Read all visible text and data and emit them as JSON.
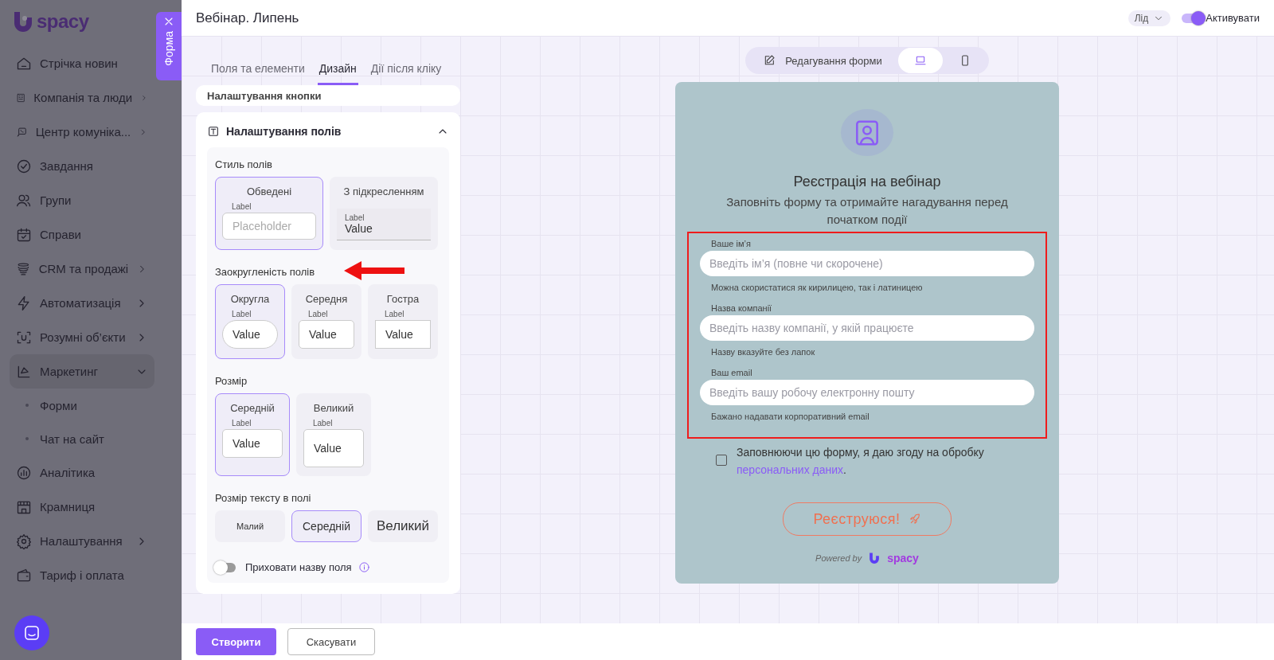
{
  "sidebar": {
    "logo": "spacy",
    "form_tab": "Форма",
    "items": [
      {
        "label": "Стрічка новин",
        "expandable": false
      },
      {
        "label": "Компанія та люди",
        "expandable": true,
        "expanded": false
      },
      {
        "label": "Центр комуніка...",
        "expandable": true,
        "expanded": false
      },
      {
        "label": "Завдання",
        "expandable": false
      },
      {
        "label": "Групи",
        "expandable": false
      },
      {
        "label": "Справи",
        "expandable": false
      },
      {
        "label": "CRM та продажі",
        "expandable": true,
        "expanded": false
      },
      {
        "label": "Автоматизація",
        "expandable": true,
        "expanded": false
      },
      {
        "label": "Розумні об’єкти",
        "expandable": true,
        "expanded": false
      },
      {
        "label": "Маркетинг",
        "expandable": true,
        "expanded": true,
        "children": [
          {
            "label": "Форми"
          },
          {
            "label": "Чат на сайт"
          }
        ]
      },
      {
        "label": "Аналітика",
        "expandable": false
      },
      {
        "label": "Крамниця",
        "expandable": false
      },
      {
        "label": "Налаштування",
        "expandable": true,
        "expanded": false
      },
      {
        "label": "Тариф і оплата",
        "expandable": false
      }
    ]
  },
  "header": {
    "title": "Вебінар. Липень",
    "entity": "Лід",
    "activate": {
      "label": "Активувати",
      "on": true
    }
  },
  "settings": {
    "tabs": [
      {
        "label": "Поля та елементи",
        "selected": false
      },
      {
        "label": "Дизайн",
        "selected": true
      },
      {
        "label": "Дії після кліку",
        "selected": false
      }
    ],
    "collapsed_section": "Налаштування кнопки",
    "section": {
      "title": "Налаштування полів",
      "expanded": true,
      "groups": [
        {
          "title": "Стиль полів",
          "kind": "style",
          "options": [
            {
              "title": "Обведені",
              "kind": "outlined",
              "selected": true,
              "label": "Label",
              "placeholder": "Placeholder"
            },
            {
              "title": "З підкресленням",
              "kind": "underlined",
              "selected": false,
              "label": "Label",
              "value": "Value"
            }
          ]
        },
        {
          "title": "Заокругленість полів",
          "kind": "radius",
          "options": [
            {
              "title": "Округла",
              "kind": "round",
              "selected": true,
              "label": "Label",
              "value": "Value"
            },
            {
              "title": "Середня",
              "kind": "medium",
              "selected": false,
              "label": "Label",
              "value": "Value"
            },
            {
              "title": "Гостра",
              "kind": "sharp",
              "selected": false,
              "label": "Label",
              "value": "Value"
            }
          ]
        },
        {
          "title": "Розмір",
          "kind": "size",
          "options": [
            {
              "title": "Середній",
              "kind": "medium",
              "selected": true,
              "label": "Label",
              "value": "Value"
            },
            {
              "title": "Великий",
              "kind": "large",
              "selected": false,
              "label": "Label",
              "value": "Value"
            }
          ]
        },
        {
          "title": "Розмір тексту в полі",
          "kind": "text",
          "options": [
            {
              "title": "Малий",
              "kind": "small",
              "selected": false
            },
            {
              "title": "Середній",
              "kind": "medium",
              "selected": true
            },
            {
              "title": "Великий",
              "kind": "large",
              "selected": false
            }
          ]
        }
      ],
      "hide_label": {
        "label": "Приховати назву поля",
        "on": false
      }
    }
  },
  "actions": [
    {
      "label": "Створити",
      "kind": "primary"
    },
    {
      "label": "Скасувати",
      "kind": "secondary"
    }
  ],
  "preview": {
    "modes": [
      {
        "label": "Редагування форми",
        "kind": "edit",
        "selected": false
      },
      {
        "kind": "desktop",
        "selected": true
      },
      {
        "kind": "mobile",
        "selected": false
      }
    ],
    "form": {
      "title": "Реєстрація на вебінар",
      "subtitle": "Заповніть форму та отримайте нагадування перед початком події",
      "fields": [
        {
          "label": "Ваше ім’я",
          "placeholder": "Введіть ім’я (повне чи скорочене)",
          "hint": "Можна скористатися як кирилицею, так і латиницею"
        },
        {
          "label": "Назва компанії",
          "placeholder": "Введіть назву компанії, у якій працюєте",
          "hint": "Назву вказуйте без лапок"
        },
        {
          "label": "Ваш email",
          "placeholder": "Введіть вашу робочу електронну пошту",
          "hint": "Бажано надавати корпоративний email"
        }
      ],
      "consent": {
        "checked": false,
        "text": "Заповнюючи цю форму, я даю згоду на обробку ",
        "link": "персональних даних",
        "after": "."
      },
      "submit": "Реєструюся!",
      "powered_by": "Powered by",
      "brand": "spacy"
    }
  }
}
